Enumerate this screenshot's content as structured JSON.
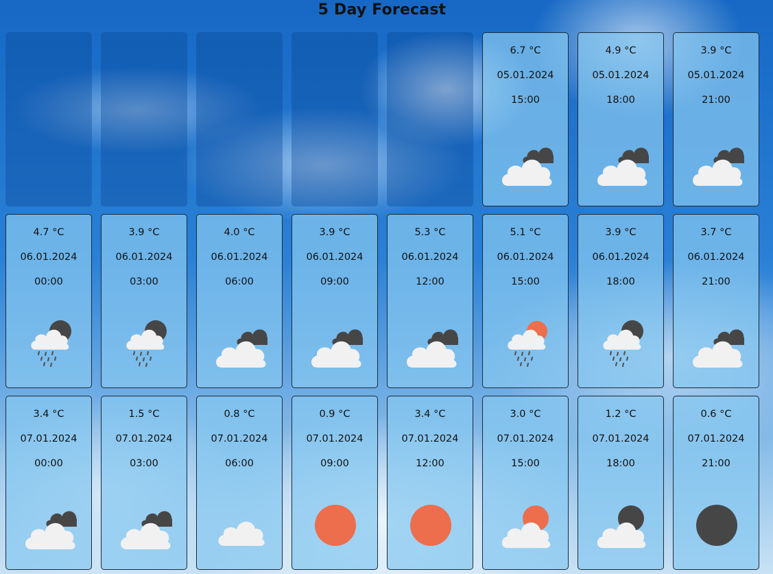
{
  "title": "5 Day Forecast",
  "colors": {
    "cloud": "#f1f1f1",
    "dark_cloud": "#474647",
    "sun": "#ec6e4c",
    "moon": "#474647",
    "rain": "#555555"
  },
  "placeholders": 5,
  "forecast": [
    {
      "temp": "6.7 °C",
      "date": "05.01.2024",
      "time": "15:00",
      "icon": "cloudy-icon"
    },
    {
      "temp": "4.9 °C",
      "date": "05.01.2024",
      "time": "18:00",
      "icon": "cloudy-icon"
    },
    {
      "temp": "3.9 °C",
      "date": "05.01.2024",
      "time": "21:00",
      "icon": "cloudy-icon"
    },
    {
      "temp": "4.7 °C",
      "date": "06.01.2024",
      "time": "00:00",
      "icon": "night-rain-icon"
    },
    {
      "temp": "3.9 °C",
      "date": "06.01.2024",
      "time": "03:00",
      "icon": "night-rain-icon"
    },
    {
      "temp": "4.0 °C",
      "date": "06.01.2024",
      "time": "06:00",
      "icon": "cloudy-icon"
    },
    {
      "temp": "3.9 °C",
      "date": "06.01.2024",
      "time": "09:00",
      "icon": "cloudy-icon"
    },
    {
      "temp": "5.3 °C",
      "date": "06.01.2024",
      "time": "12:00",
      "icon": "cloudy-icon"
    },
    {
      "temp": "5.1 °C",
      "date": "06.01.2024",
      "time": "15:00",
      "icon": "day-rain-icon"
    },
    {
      "temp": "3.9 °C",
      "date": "06.01.2024",
      "time": "18:00",
      "icon": "night-rain-icon"
    },
    {
      "temp": "3.7 °C",
      "date": "06.01.2024",
      "time": "21:00",
      "icon": "cloudy-icon"
    },
    {
      "temp": "3.4 °C",
      "date": "07.01.2024",
      "time": "00:00",
      "icon": "cloudy-icon"
    },
    {
      "temp": "1.5 °C",
      "date": "07.01.2024",
      "time": "03:00",
      "icon": "cloudy-icon"
    },
    {
      "temp": "0.8 °C",
      "date": "07.01.2024",
      "time": "06:00",
      "icon": "cloud-icon"
    },
    {
      "temp": "0.9 °C",
      "date": "07.01.2024",
      "time": "09:00",
      "icon": "sun-icon"
    },
    {
      "temp": "3.4 °C",
      "date": "07.01.2024",
      "time": "12:00",
      "icon": "sun-icon"
    },
    {
      "temp": "3.0 °C",
      "date": "07.01.2024",
      "time": "15:00",
      "icon": "partly-cloudy-day-icon"
    },
    {
      "temp": "1.2 °C",
      "date": "07.01.2024",
      "time": "18:00",
      "icon": "partly-cloudy-night-icon"
    },
    {
      "temp": "0.6 °C",
      "date": "07.01.2024",
      "time": "21:00",
      "icon": "clear-night-icon"
    }
  ]
}
